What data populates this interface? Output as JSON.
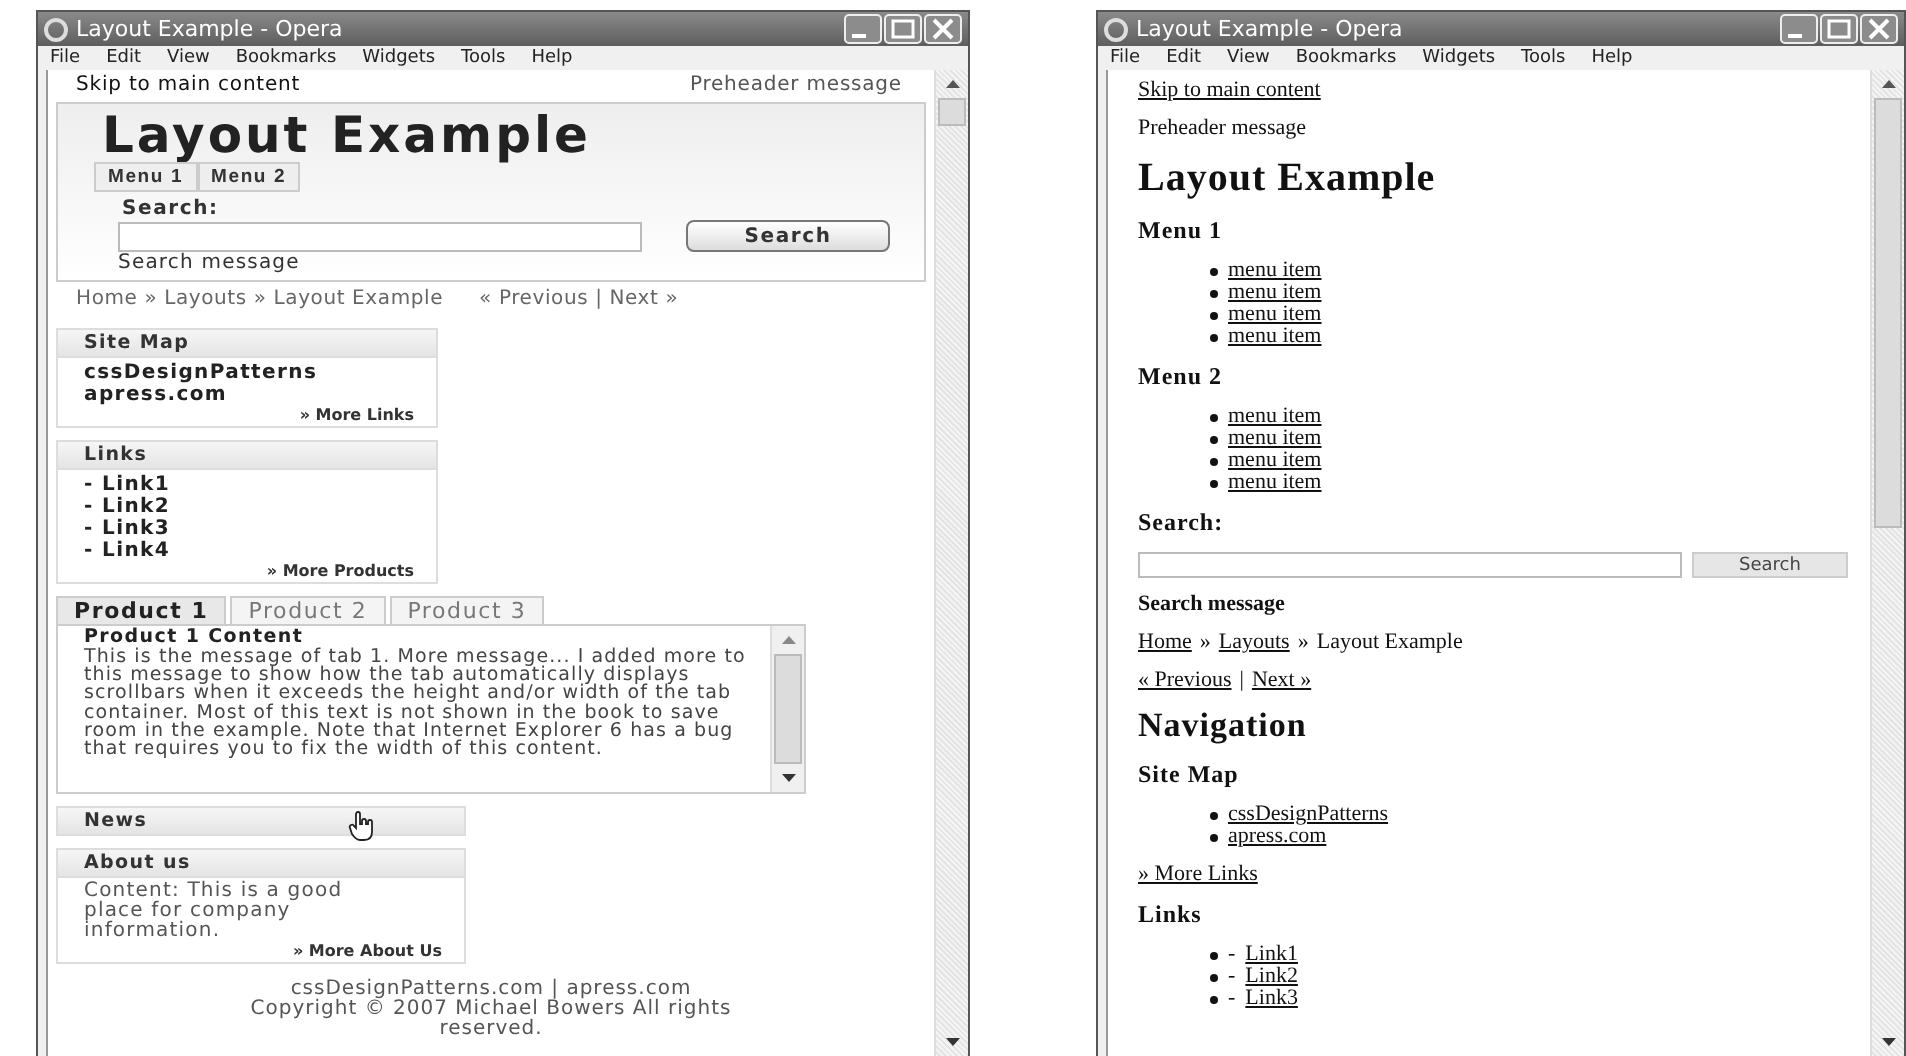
{
  "left_window": {
    "title": "Layout Example - Opera",
    "menu": [
      "File",
      "Edit",
      "View",
      "Bookmarks",
      "Widgets",
      "Tools",
      "Help"
    ],
    "page": {
      "skip_link": "Skip to main content",
      "preheader": "Preheader message",
      "site_title": "Layout Example",
      "menus": [
        "Menu 1",
        "Menu 2"
      ],
      "search_label": "Search:",
      "search_button": "Search",
      "search_message": "Search message",
      "breadcrumb": "Home » Layouts » Layout Example",
      "prev_next": "« Previous | Next »",
      "site_map": {
        "title": "Site Map",
        "items": [
          "cssDesignPatterns",
          "apress.com"
        ],
        "more": "» More Links"
      },
      "links": {
        "title": "Links",
        "items": [
          "- Link1",
          "- Link2",
          "- Link3",
          "- Link4"
        ],
        "more": "» More Products"
      },
      "tabs": [
        {
          "label": "Product 1",
          "selected": true
        },
        {
          "label": "Product 2",
          "selected": false
        },
        {
          "label": "Product 3",
          "selected": false
        }
      ],
      "tab_content": {
        "heading": "Product 1 Content",
        "body": "This is the message of tab 1. More message... I added more to this message to show how the tab automatically displays scrollbars when it exceeds the height and/or width of the tab container. Most of this text is not shown in the book to save room in the example. Note that Internet Explorer 6 has a bug that requires you to fix the width of this content."
      },
      "news": {
        "title": "News"
      },
      "about": {
        "title": "About us",
        "body": "Content: This is a good place for company information.",
        "more": "» More About Us"
      },
      "footer": [
        "cssDesignPatterns.com | apress.com",
        "Copyright © 2007 Michael Bowers All rights reserved."
      ]
    }
  },
  "right_window": {
    "title": "Layout Example - Opera",
    "menu": [
      "File",
      "Edit",
      "View",
      "Bookmarks",
      "Widgets",
      "Tools",
      "Help"
    ],
    "page": {
      "skip_link": "Skip to main content",
      "preheader": "Preheader message",
      "site_title": "Layout Example",
      "menus": [
        {
          "title": "Menu 1",
          "items": [
            "menu item",
            "menu item",
            "menu item",
            "menu item"
          ]
        },
        {
          "title": "Menu 2",
          "items": [
            "menu item",
            "menu item",
            "menu item",
            "menu item"
          ]
        }
      ],
      "search_label": "Search:",
      "search_button": "Search",
      "search_message": "Search message",
      "breadcrumb": [
        {
          "text": "Home",
          "link": true
        },
        {
          "text": "»",
          "link": false
        },
        {
          "text": "Layouts",
          "link": true
        },
        {
          "text": "»",
          "link": false
        },
        {
          "text": "Layout Example",
          "link": false
        }
      ],
      "prev": "« Previous",
      "separator": "|",
      "next": "Next »",
      "nav_title": "Navigation",
      "site_map": {
        "title": "Site Map",
        "items": [
          "cssDesignPatterns",
          "apress.com"
        ],
        "more": "» More Links"
      },
      "links": {
        "title": "Links",
        "items": [
          {
            "prefix": "-",
            "label": "Link1"
          },
          {
            "prefix": "-",
            "label": "Link2"
          },
          {
            "prefix": "-",
            "label": "Link3"
          }
        ]
      }
    }
  }
}
